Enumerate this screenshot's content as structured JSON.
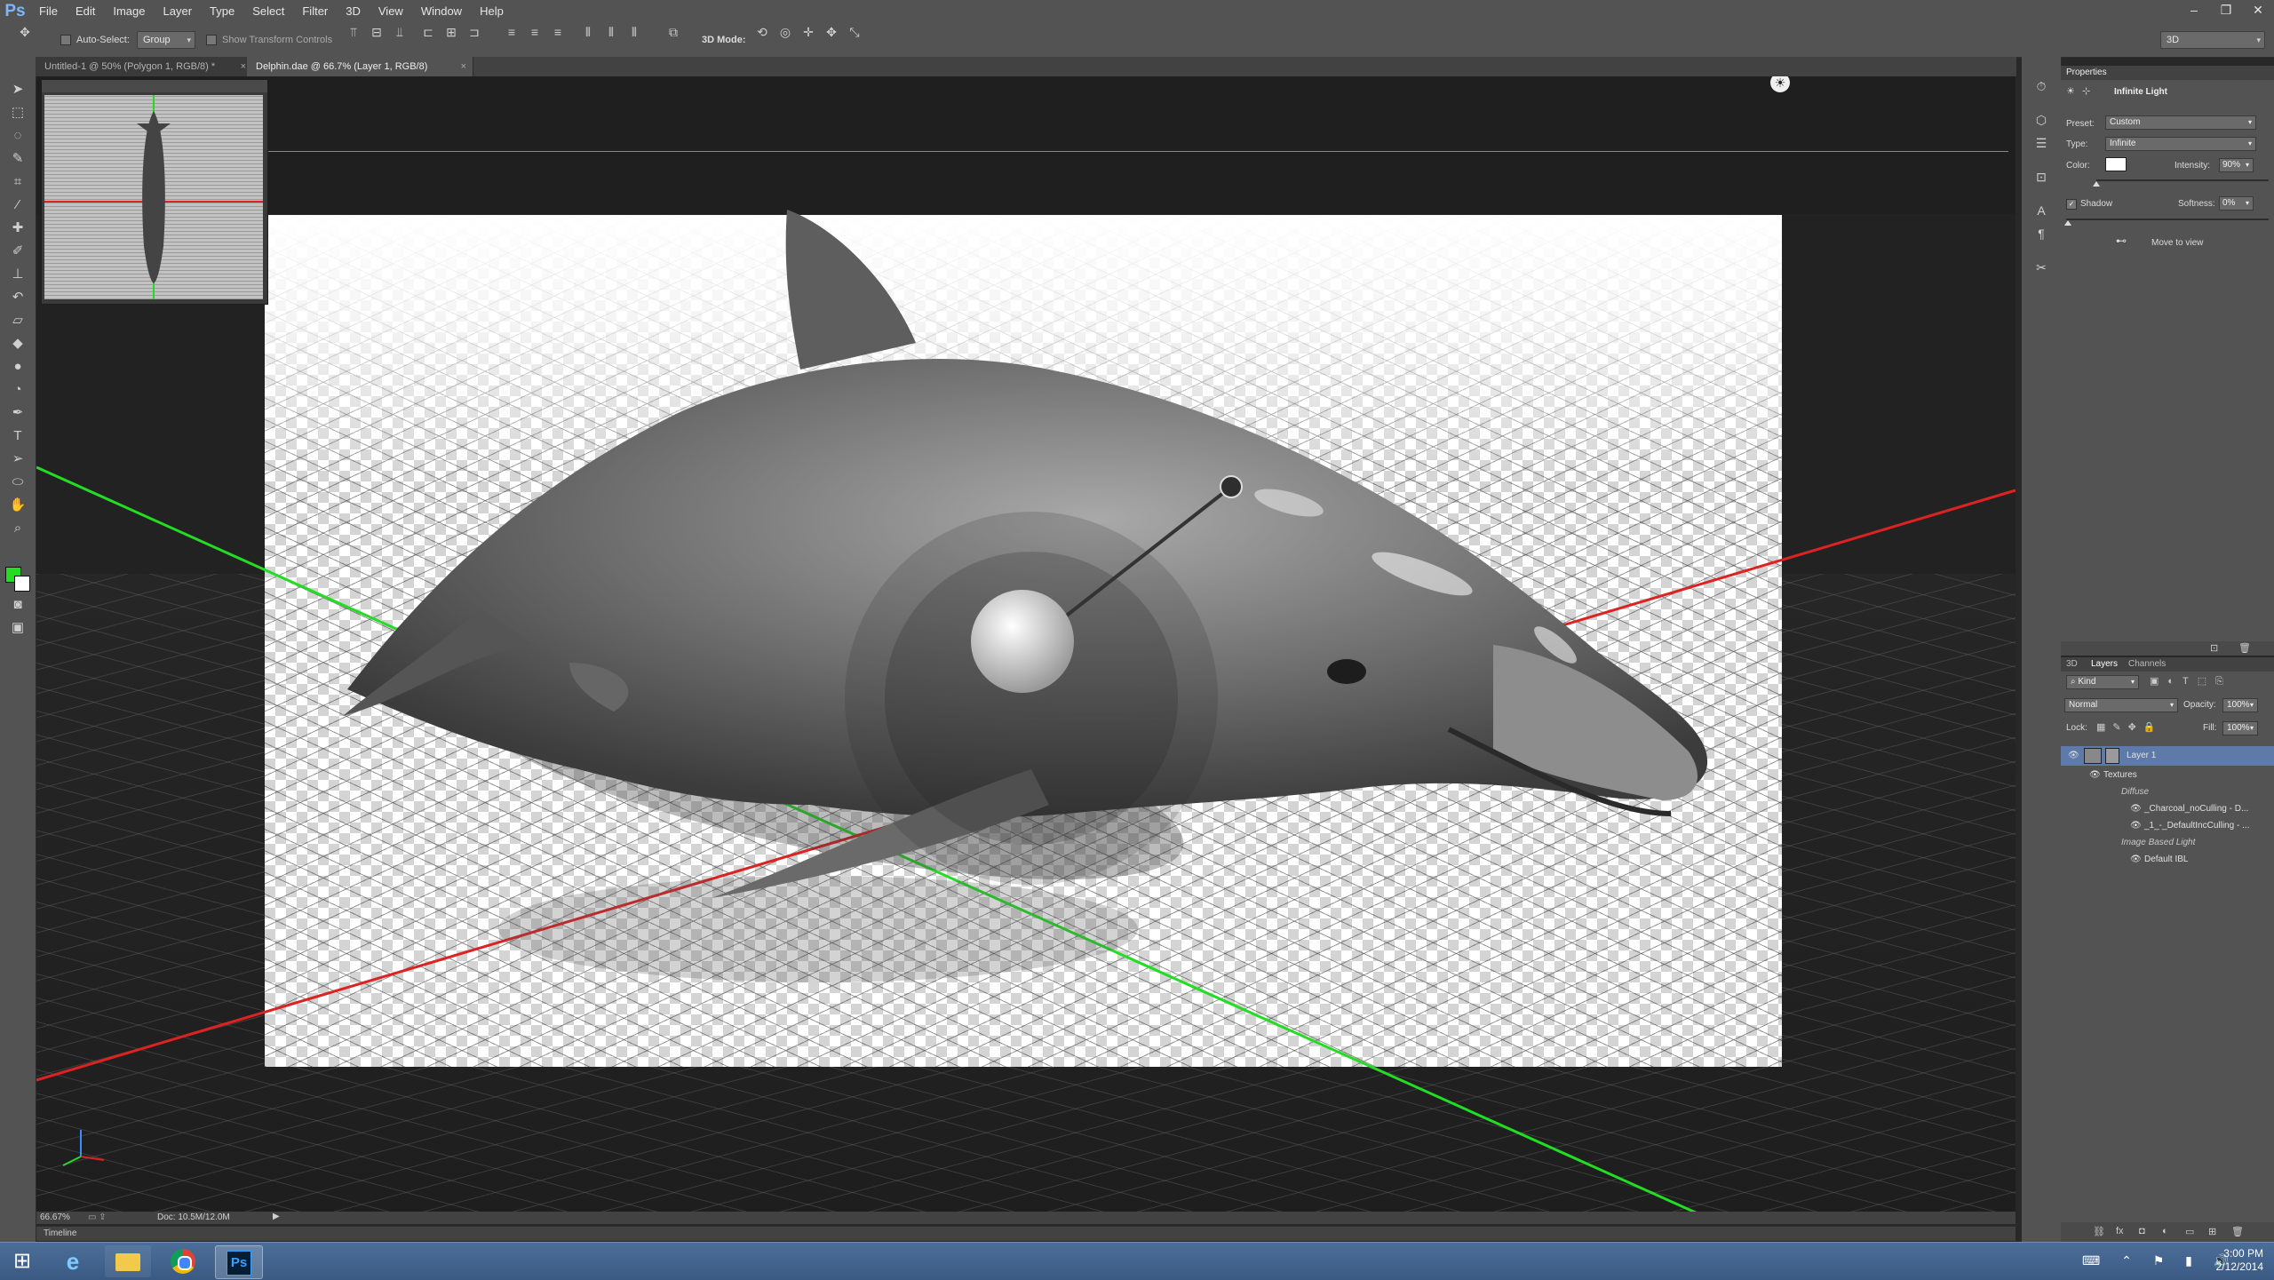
{
  "menubar": {
    "app_logo": "Ps",
    "items": [
      "File",
      "Edit",
      "Image",
      "Layer",
      "Type",
      "Select",
      "Filter",
      "3D",
      "View",
      "Window",
      "Help"
    ]
  },
  "window_controls": {
    "minimize": "–",
    "restore": "❐",
    "close": "✕"
  },
  "options_bar": {
    "auto_select_label": "Auto-Select:",
    "auto_select_value": "Group",
    "show_transform_controls": "Show Transform Controls",
    "mode_3d_label": "3D Mode:",
    "workspace_value": "3D"
  },
  "tabs": [
    {
      "label": "Untitled-1 @ 50% (Polygon 1, RGB/8) *",
      "active": false
    },
    {
      "label": "Delphin.dae @ 66.7% (Layer 1, RGB/8)",
      "active": true
    }
  ],
  "status_bar": {
    "zoom": "66.67%",
    "doc_size": "Doc: 10.5M/12.0M"
  },
  "timeline_label": "Timeline",
  "properties": {
    "panel_title": "Properties",
    "section_title": "Infinite Light",
    "preset_label": "Preset:",
    "preset_value": "Custom",
    "type_label": "Type:",
    "type_value": "Infinite",
    "color_label": "Color:",
    "color_value": "#ffffff",
    "intensity_label": "Intensity:",
    "intensity_value": "90%",
    "shadow_label": "Shadow",
    "softness_label": "Softness:",
    "softness_value": "0%",
    "move_to_view": "Move to view"
  },
  "layers_panel": {
    "tabs": [
      "3D",
      "Layers",
      "Channels"
    ],
    "filter_kind": "Kind",
    "blend_mode": "Normal",
    "opacity_label": "Opacity:",
    "opacity_value": "100%",
    "lock_label": "Lock:",
    "fill_label": "Fill:",
    "fill_value": "100%",
    "layer_name": "Layer 1",
    "rows": [
      {
        "label": "Textures",
        "indent": 1
      },
      {
        "label": "Diffuse",
        "indent": 2
      },
      {
        "label": "_Charcoal_noCulling - D...",
        "indent": 3
      },
      {
        "label": "_1_-_DefaultIncCulling - ...",
        "indent": 3
      },
      {
        "label": "Image Based Light",
        "indent": 2
      },
      {
        "label": "Default IBL",
        "indent": 3
      }
    ]
  },
  "taskbar": {
    "time": "3:00 PM",
    "date": "2/12/2014",
    "ps_label": "Ps"
  },
  "colors": {
    "panel": "#535353",
    "accent_green": "#22dd22",
    "accent_red": "#dd2222",
    "taskbar": "#3d5f8a"
  }
}
